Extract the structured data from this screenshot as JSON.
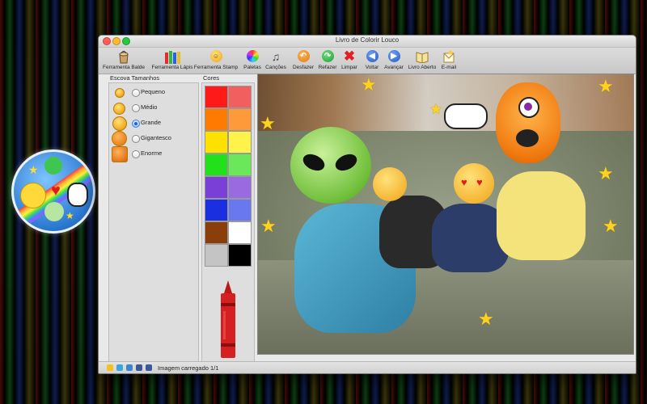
{
  "window": {
    "title": "Livro de Colorir Louco"
  },
  "toolbar": {
    "items": [
      {
        "label": "Ferramenta Balde",
        "icon": "paint-bucket-icon"
      },
      {
        "label": "Ferramenta Lápis",
        "icon": "crayons-icon"
      },
      {
        "label": "Ferramenta Stamp",
        "icon": "stamp-face-icon"
      },
      {
        "label": "Paletas",
        "icon": "palette-icon"
      },
      {
        "label": "Canções",
        "icon": "music-note-icon"
      },
      {
        "label": "Desfazer",
        "icon": "undo-icon"
      },
      {
        "label": "Refazer",
        "icon": "redo-icon"
      },
      {
        "label": "Limpar",
        "icon": "clear-x-icon"
      },
      {
        "label": "Voltar",
        "icon": "back-arrow-icon"
      },
      {
        "label": "Avançar",
        "icon": "forward-arrow-icon"
      },
      {
        "label": "Livro Aberto",
        "icon": "open-book-icon"
      },
      {
        "label": "E-mail",
        "icon": "email-icon"
      }
    ]
  },
  "brush": {
    "title": "Escova Tamanhos",
    "sizes": [
      {
        "label": "Pequeno",
        "selected": false
      },
      {
        "label": "Médio",
        "selected": false
      },
      {
        "label": "Grande",
        "selected": true
      },
      {
        "label": "Gigantesco",
        "selected": false
      },
      {
        "label": "Enorme",
        "selected": false
      }
    ]
  },
  "colors": {
    "title": "Cores",
    "swatches": [
      "#ff1a1a",
      "#f25f5f",
      "#ff7a00",
      "#ff9a3a",
      "#ffe100",
      "#fff24a",
      "#22e01a",
      "#6be85a",
      "#7a3fd6",
      "#9a6ae0",
      "#1a2fe0",
      "#6a78f0",
      "#8a3e0a",
      "#ffffff",
      "#c4c4c4",
      "#000000"
    ],
    "selected_tool_color": "#d42020"
  },
  "status": {
    "text": "Imagem carregado 1/1"
  }
}
